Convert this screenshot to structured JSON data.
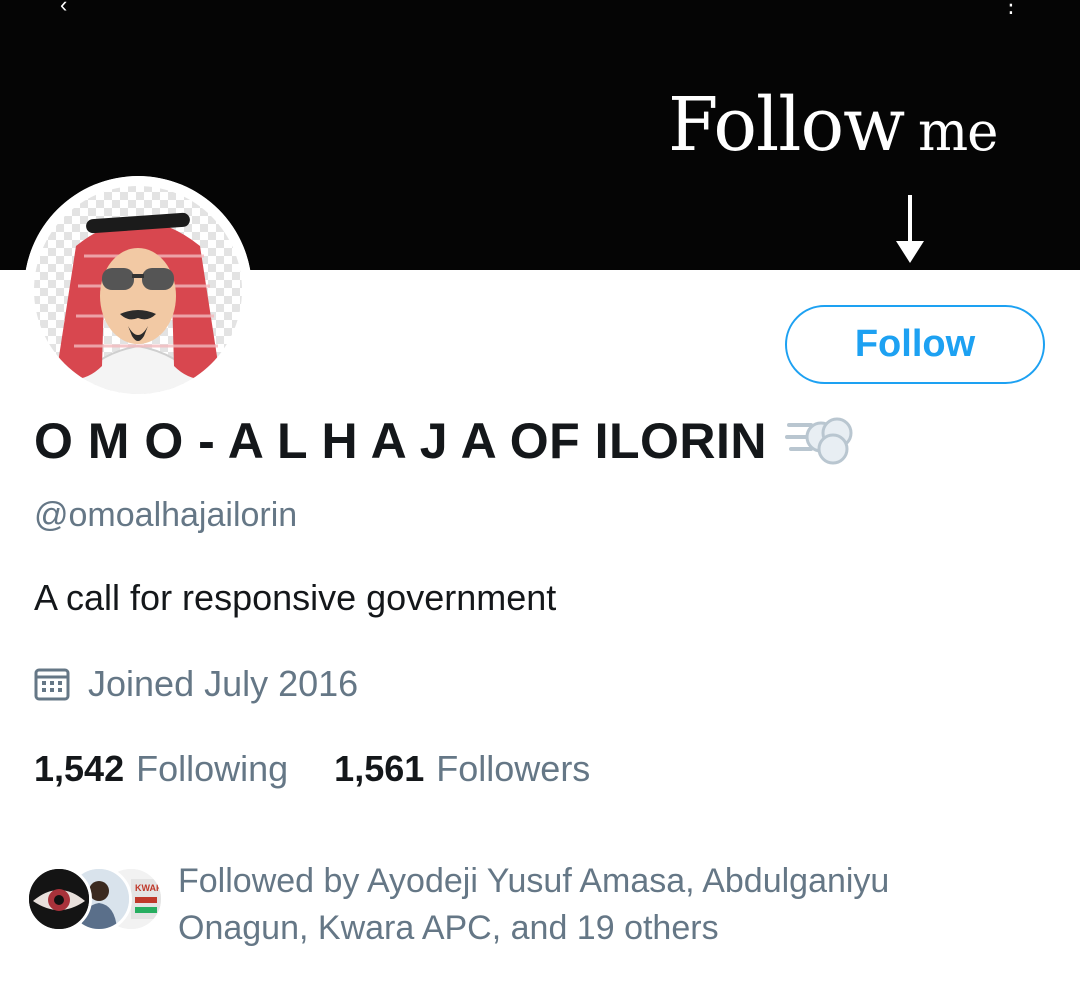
{
  "banner": {
    "headline_main": "Follow",
    "headline_me": "me",
    "arrow_icon": "down-arrow-icon",
    "background_color": "#050505"
  },
  "profile": {
    "avatar_icon": "keffiyeh-portrait-avatar",
    "follow_button_label": "Follow",
    "display_name": "O M O - A L H A J A OF ILORIN",
    "name_emoji": "dash-symbol-emoji",
    "handle": "@omoalhajailorin",
    "bio": "A call for responsive government",
    "joined_icon": "calendar-icon",
    "joined": "Joined July 2016",
    "accent_color": "#1da1f2",
    "secondary_text_color": "#657786"
  },
  "stats": {
    "following_count": "1,542",
    "following_label": "Following",
    "followers_count": "1,561",
    "followers_label": "Followers"
  },
  "followed_by": {
    "text": "Followed by Ayodeji Yusuf Amasa, Abdulganiyu Onagun, Kwara APC, and 19 others",
    "avatars": [
      "eye-avatar",
      "person-avatar",
      "kwara-apc-avatar"
    ]
  }
}
